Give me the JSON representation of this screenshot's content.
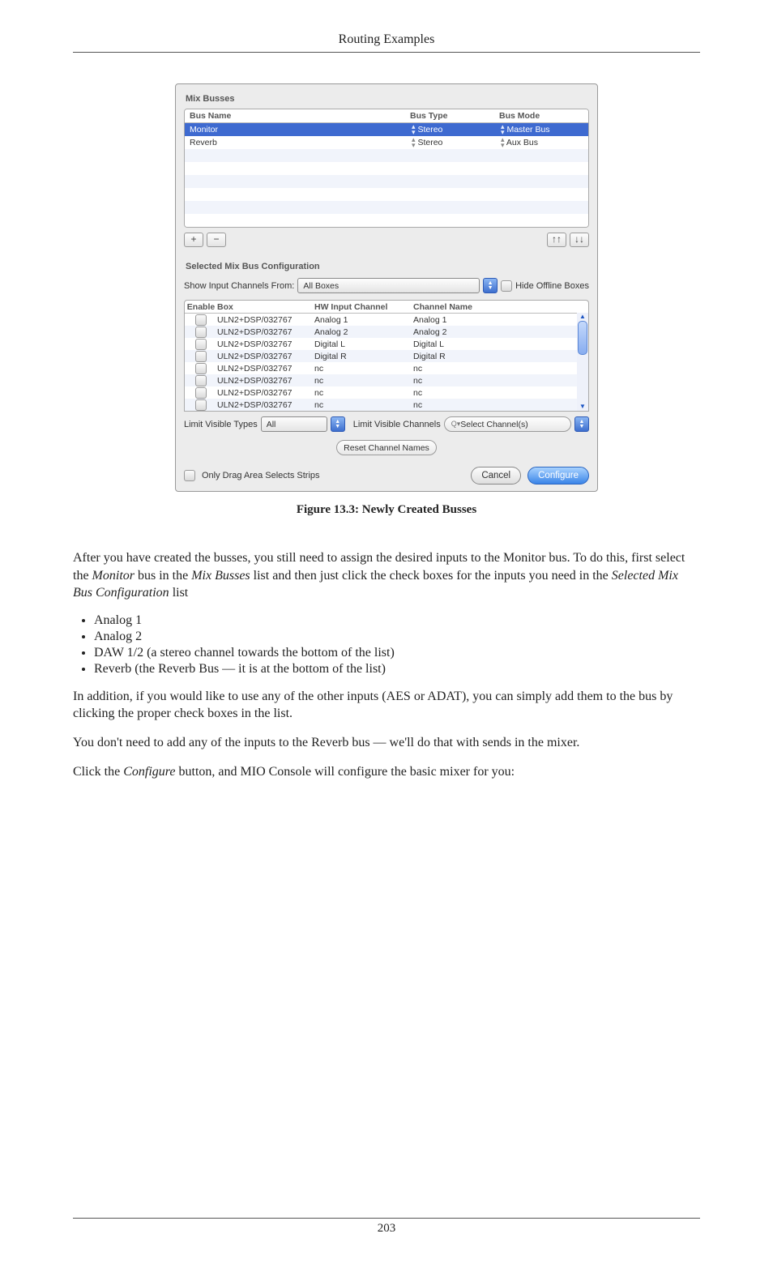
{
  "header": {
    "title": "Routing Examples"
  },
  "figure": {
    "caption": "Figure 13.3: Newly Created Busses",
    "mix_busses_label": "Mix Busses",
    "bus_table": {
      "headers": {
        "name": "Bus Name",
        "type": "Bus Type",
        "mode": "Bus Mode"
      },
      "rows": [
        {
          "name": "Monitor",
          "type": "Stereo",
          "mode": "Master Bus",
          "selected": true
        },
        {
          "name": "Reverb",
          "type": "Stereo",
          "mode": "Aux Bus",
          "selected": false
        }
      ]
    },
    "toolbar": {
      "add": "+",
      "remove": "−",
      "up": "↑↑",
      "down": "↓↓"
    },
    "config_label": "Selected Mix Bus Configuration",
    "show_input": {
      "label": "Show Input Channels From:",
      "value": "All Boxes",
      "hide_offline": "Hide Offline Boxes"
    },
    "ch_table": {
      "headers": {
        "enable": "Enable",
        "box": "Box",
        "hw": "HW Input Channel",
        "name": "Channel Name"
      },
      "rows": [
        {
          "box": "ULN2+DSP/032767",
          "hw": "Analog 1",
          "name": "Analog 1"
        },
        {
          "box": "ULN2+DSP/032767",
          "hw": "Analog 2",
          "name": "Analog 2"
        },
        {
          "box": "ULN2+DSP/032767",
          "hw": "Digital L",
          "name": "Digital L"
        },
        {
          "box": "ULN2+DSP/032767",
          "hw": "Digital R",
          "name": "Digital R"
        },
        {
          "box": "ULN2+DSP/032767",
          "hw": "nc",
          "name": "nc"
        },
        {
          "box": "ULN2+DSP/032767",
          "hw": "nc",
          "name": "nc"
        },
        {
          "box": "ULN2+DSP/032767",
          "hw": "nc",
          "name": "nc"
        },
        {
          "box": "ULN2+DSP/032767",
          "hw": "nc",
          "name": "nc"
        }
      ]
    },
    "limit": {
      "types_label": "Limit Visible Types",
      "types_value": "All",
      "channels_label": "Limit Visible Channels",
      "channels_value": "Select Channel(s)"
    },
    "reset_btn": "Reset Channel Names",
    "drag_checkbox": "Only Drag Area Selects Strips",
    "cancel": "Cancel",
    "configure": "Configure"
  },
  "body": {
    "p1a": "After you have created the busses, you still need to assign the desired inputs to the Monitor bus. To do this, first select the ",
    "p1b": "Monitor",
    "p1c": " bus in the ",
    "p1d": "Mix Busses",
    "p1e": " list and then just click the check boxes for the inputs you need in the ",
    "p1f": "Selected Mix Bus Configuration",
    "p1g": " list",
    "li1": "Analog 1",
    "li2": "Analog 2",
    "li3": "DAW 1/2 (a stereo channel towards the bottom of the list)",
    "li4": "Reverb (the Reverb Bus — it is at the bottom of the list)",
    "p2": "In addition, if you would like to use any of the other inputs (AES or ADAT), you can simply add them to the bus by clicking the proper check boxes in the list.",
    "p3": "You don't need to add any of the inputs to the Reverb bus — we'll do that with sends in the mixer.",
    "p4a": "Click the ",
    "p4b": "Configure",
    "p4c": " button, and MIO Console will configure the basic mixer for you:"
  },
  "footer": {
    "page": "203"
  }
}
